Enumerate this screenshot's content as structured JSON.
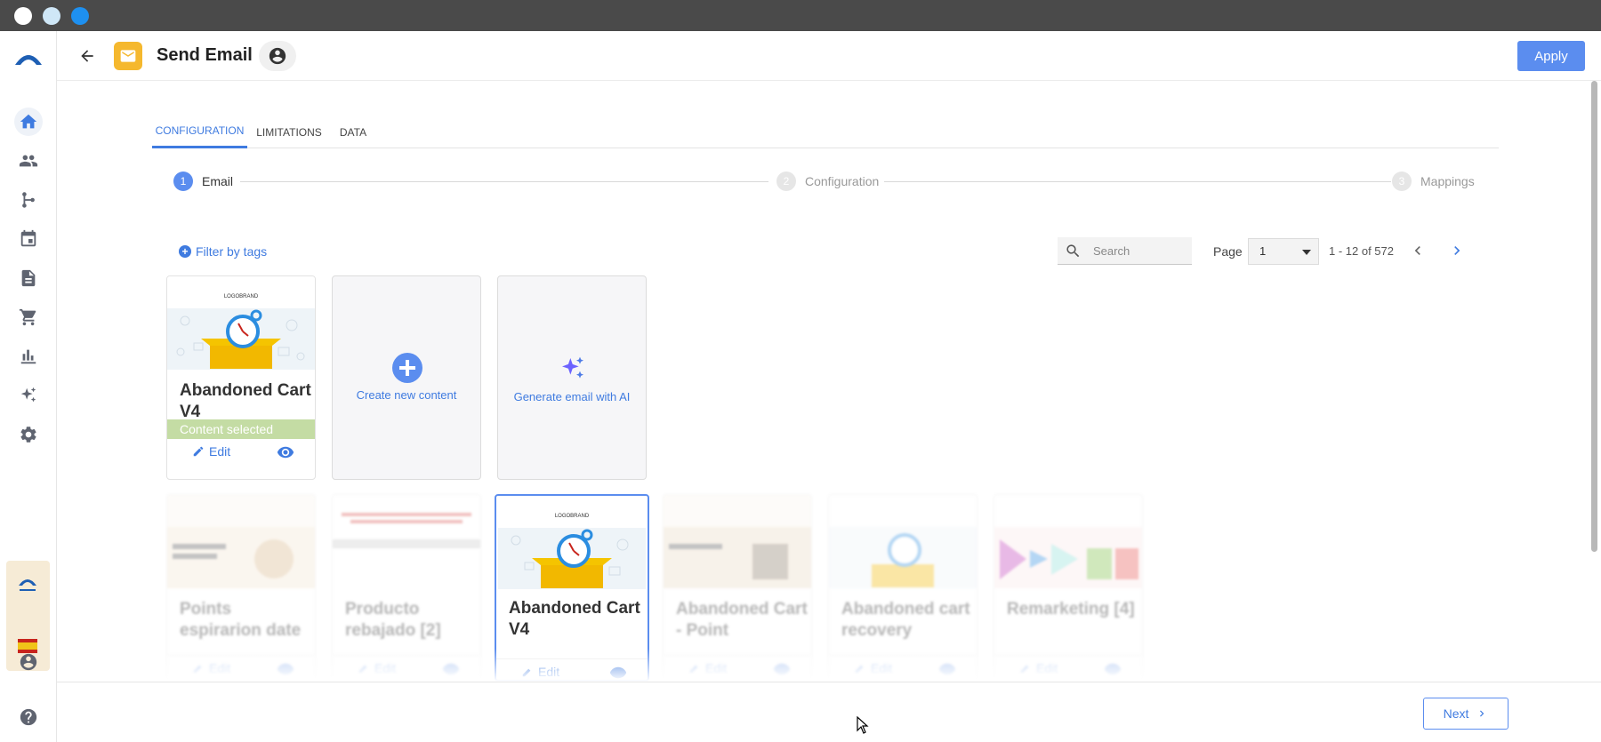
{
  "window": {
    "controls": [
      "close",
      "minimize",
      "maximize"
    ]
  },
  "header": {
    "title": "Send Email",
    "apply_label": "Apply"
  },
  "sidebar": {
    "items": [
      {
        "name": "home",
        "active": true
      },
      {
        "name": "contacts"
      },
      {
        "name": "workflows"
      },
      {
        "name": "calendar"
      },
      {
        "name": "documents"
      },
      {
        "name": "cart"
      },
      {
        "name": "analytics"
      },
      {
        "name": "ai"
      },
      {
        "name": "settings"
      }
    ]
  },
  "tabs": [
    {
      "label": "CONFIGURATION",
      "active": true
    },
    {
      "label": "LIMITATIONS"
    },
    {
      "label": "DATA"
    }
  ],
  "stepper": [
    {
      "num": "1",
      "label": "Email",
      "active": true
    },
    {
      "num": "2",
      "label": "Configuration"
    },
    {
      "num": "3",
      "label": "Mappings"
    }
  ],
  "toolbar": {
    "filter_label": "Filter by tags",
    "search_placeholder": "Search",
    "page_label": "Page",
    "page_value": "1",
    "range_label": "1 - 12 of 572"
  },
  "selected_card": {
    "title": "Abandoned Cart V4",
    "status": "Content selected",
    "edit_label": "Edit"
  },
  "create_card": {
    "label": "Create new content"
  },
  "ai_card": {
    "label": "Generate email with AI"
  },
  "templates": [
    {
      "title": "Points espirarion date",
      "edit_label": "Edit"
    },
    {
      "title": "Producto rebajado [2]",
      "edit_label": "Edit"
    },
    {
      "title": "Abandoned Cart V4",
      "edit_label": "Edit",
      "highlighted": true
    },
    {
      "title": "Abandoned Cart - Point",
      "edit_label": "Edit"
    },
    {
      "title": "Abandoned cart recovery",
      "edit_label": "Edit"
    },
    {
      "title": "Remarketing [4]",
      "edit_label": "Edit"
    }
  ],
  "thumb": {
    "brand_logo": "LOGOBRAND"
  },
  "footer": {
    "next_label": "Next"
  },
  "colors": {
    "accent": "#5b8def",
    "link": "#3f7be0",
    "badge": "#f5b82e",
    "selected": "#c4dca4"
  }
}
